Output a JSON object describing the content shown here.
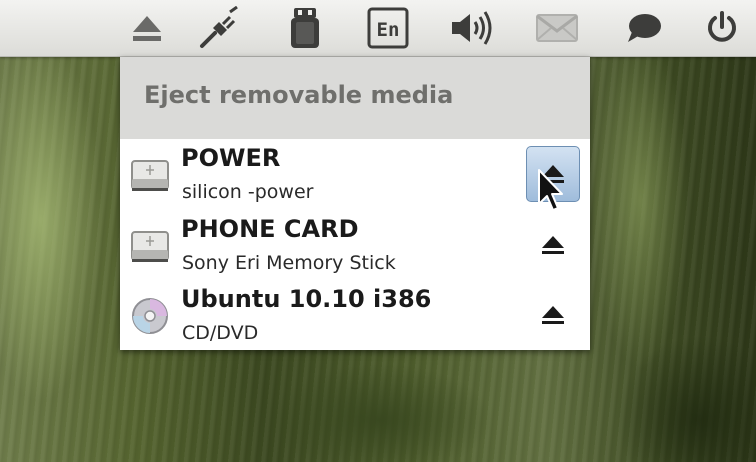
{
  "panel": {
    "indicators": [
      {
        "icon": "eject-icon"
      },
      {
        "icon": "network-plug-icon"
      },
      {
        "icon": "usb-drive-icon"
      },
      {
        "icon": "keyboard-layout-icon",
        "label": "En"
      },
      {
        "icon": "volume-icon"
      },
      {
        "icon": "mail-icon"
      },
      {
        "icon": "chat-bubble-icon"
      },
      {
        "icon": "power-icon"
      }
    ]
  },
  "menu": {
    "title": "Eject removable media",
    "items": [
      {
        "name": "POWER",
        "description": "silicon -power",
        "icon": "usb-drive-icon",
        "hovered": true
      },
      {
        "name": "PHONE CARD",
        "description": "Sony Eri Memory Stick",
        "icon": "usb-drive-icon",
        "hovered": false
      },
      {
        "name": "Ubuntu 10.10 i386",
        "description": "CD/DVD",
        "icon": "optical-disc-icon",
        "hovered": false
      }
    ]
  },
  "colors": {
    "panel_top": "#f3f3f1",
    "panel_bottom": "#dcdcd8",
    "header_bg": "#dadad8",
    "hover_highlight": "#9fbcdb",
    "icon_gray": "#4a4a48"
  }
}
